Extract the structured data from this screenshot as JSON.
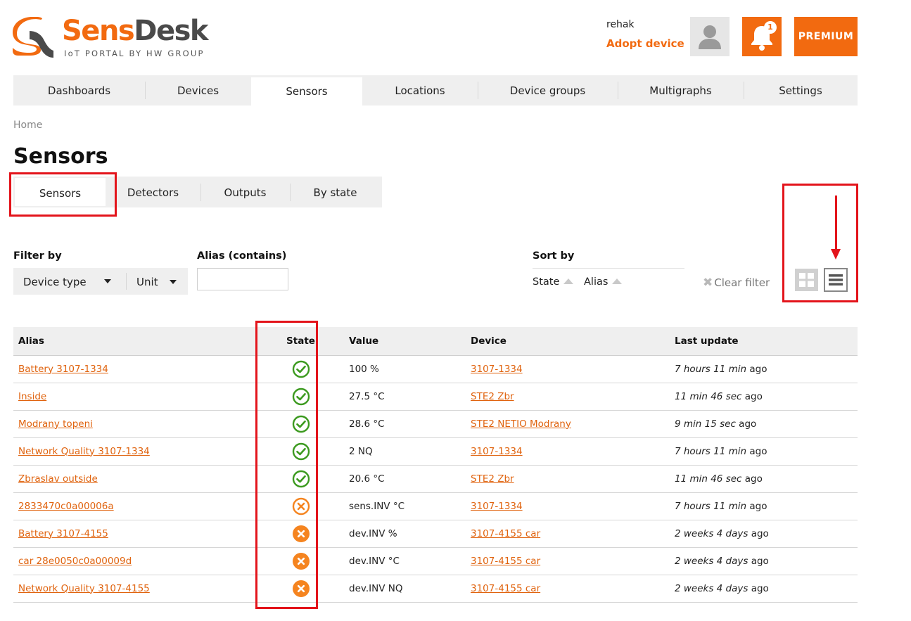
{
  "brand": {
    "word_orange": "Sens",
    "word_gray": "Desk",
    "tagline": "IoT PORTAL BY HW GROUP",
    "accent_color": "#f26a10"
  },
  "header": {
    "username": "rehak",
    "adopt_label": "Adopt device",
    "notification_count": "1",
    "premium_label": "PREMIUM",
    "avatar_icon": "user-icon",
    "bell_icon": "bell-icon"
  },
  "nav": {
    "items": [
      {
        "label": "Dashboards"
      },
      {
        "label": "Devices"
      },
      {
        "label": "Sensors",
        "active": true
      },
      {
        "label": "Locations"
      },
      {
        "label": "Device groups"
      },
      {
        "label": "Multigraphs"
      },
      {
        "label": "Settings"
      }
    ]
  },
  "breadcrumb": "Home",
  "page_title": "Sensors",
  "subtabs": {
    "items": [
      {
        "label": "Sensors",
        "active": true
      },
      {
        "label": "Detectors"
      },
      {
        "label": "Outputs"
      },
      {
        "label": "By state"
      }
    ]
  },
  "filters": {
    "filter_by_label": "Filter by",
    "device_type_label": "Device type",
    "unit_label": "Unit",
    "alias_label": "Alias (contains)",
    "alias_value": "",
    "sort_by_label": "Sort by",
    "sort_state_label": "State",
    "sort_alias_label": "Alias",
    "clear_filter_label": "Clear filter"
  },
  "view_toggle": {
    "grid_icon": "grid-view-icon",
    "list_icon": "list-view-icon",
    "selected": "list"
  },
  "table": {
    "columns": {
      "alias": "Alias",
      "state": "State",
      "value": "Value",
      "device": "Device",
      "last_update": "Last update"
    },
    "rows": [
      {
        "alias": "Battery 3107-1334",
        "state": "ok",
        "value": "100 %",
        "device": "3107-1334",
        "time": "7 hours 11 min",
        "ago": " ago"
      },
      {
        "alias": "Inside",
        "state": "ok",
        "value": "27.5 °C",
        "device": "STE2 Zbr",
        "time": "11 min 46 sec",
        "ago": " ago"
      },
      {
        "alias": "Modrany topeni",
        "state": "ok",
        "value": "28.6 °C",
        "device": "STE2 NETIO Modrany",
        "time": "9 min 15 sec",
        "ago": " ago"
      },
      {
        "alias": "Network Quality 3107-1334",
        "state": "ok",
        "value": "2 NQ",
        "device": "3107-1334",
        "time": "7 hours 11 min",
        "ago": " ago"
      },
      {
        "alias": "Zbraslav outside",
        "state": "ok",
        "value": "20.6 °C",
        "device": "STE2 Zbr",
        "time": "11 min 46 sec",
        "ago": " ago"
      },
      {
        "alias": "2833470c0a00006a",
        "state": "warning",
        "value": "sens.INV °C",
        "device": "3107-1334",
        "time": "7 hours 11 min",
        "ago": " ago"
      },
      {
        "alias": "Battery 3107-4155",
        "state": "error",
        "value": "dev.INV %",
        "device": "3107-4155 car",
        "time": "2 weeks 4 days",
        "ago": " ago"
      },
      {
        "alias": "car 28e0050c0a00009d",
        "state": "error",
        "value": "dev.INV °C",
        "device": "3107-4155 car",
        "time": "2 weeks 4 days",
        "ago": " ago"
      },
      {
        "alias": "Network Quality 3107-4155",
        "state": "error",
        "value": "dev.INV NQ",
        "device": "3107-4155 car",
        "time": "2 weeks 4 days",
        "ago": " ago"
      }
    ]
  },
  "state_icons": {
    "ok": {
      "icon": "check-circle-icon",
      "color": "#3c9a1f"
    },
    "warning": {
      "icon": "x-circle-outline-icon",
      "color": "#f5841f"
    },
    "error": {
      "icon": "x-circle-filled-icon",
      "color": "#f5841f"
    }
  },
  "annotation": {
    "color": "#e3141b"
  }
}
